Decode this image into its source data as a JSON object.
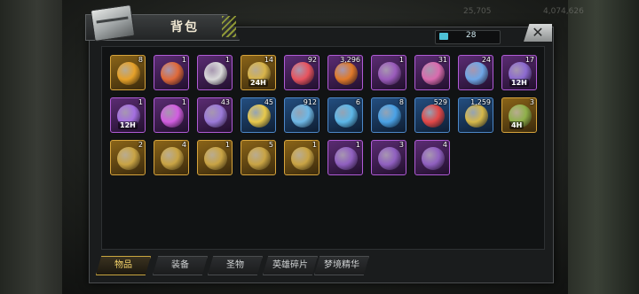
{
  "window": {
    "title": "背包"
  },
  "background": {
    "res_1": "25,705",
    "res_2": "4,074,626"
  },
  "capacity": {
    "value": "28"
  },
  "close_label": "✕",
  "items": [
    {
      "count": "8",
      "rarity": "gold",
      "glyph": "pumpkin-icon",
      "color": "#e6a12a",
      "badge": ""
    },
    {
      "count": "1",
      "rarity": "purple",
      "glyph": "orb-icon",
      "color": "#e06a3a",
      "badge": ""
    },
    {
      "count": "1",
      "rarity": "purple",
      "glyph": "medal-icon",
      "color": "#d9d9d9",
      "badge": ""
    },
    {
      "count": "14",
      "rarity": "gold",
      "glyph": "card-icon",
      "color": "#d8b44a",
      "badge": "24H"
    },
    {
      "count": "92",
      "rarity": "purple",
      "glyph": "bottlecap-icon",
      "color": "#e8545f",
      "badge": ""
    },
    {
      "count": "3,296",
      "rarity": "purple",
      "glyph": "pumpkin-icon",
      "color": "#e07a2a",
      "badge": ""
    },
    {
      "count": "1",
      "rarity": "purple",
      "glyph": "box-icon",
      "color": "#9a5bbb",
      "badge": ""
    },
    {
      "count": "31",
      "rarity": "purple",
      "glyph": "film-icon",
      "color": "#d96cae",
      "badge": ""
    },
    {
      "count": "24",
      "rarity": "purple",
      "glyph": "disc-icon",
      "color": "#6fa6e6",
      "badge": ""
    },
    {
      "count": "17",
      "rarity": "purple",
      "glyph": "card-icon",
      "color": "#8c6ad0",
      "badge": "12H"
    },
    {
      "count": "1",
      "rarity": "purple",
      "glyph": "card-icon",
      "color": "#a46fe0",
      "badge": "12H"
    },
    {
      "count": "1",
      "rarity": "purple",
      "glyph": "gem-icon",
      "color": "#d25ee0",
      "badge": ""
    },
    {
      "count": "43",
      "rarity": "purple",
      "glyph": "badge-icon",
      "color": "#9b7ad9",
      "badge": ""
    },
    {
      "count": "45",
      "rarity": "blue",
      "glyph": "star-icon",
      "color": "#e8c94c",
      "badge": ""
    },
    {
      "count": "912",
      "rarity": "blue",
      "glyph": "ticket-icon",
      "color": "#6fb8e6",
      "badge": ""
    },
    {
      "count": "6",
      "rarity": "blue",
      "glyph": "coin-icon",
      "color": "#5db7e8",
      "badge": ""
    },
    {
      "count": "8",
      "rarity": "blue",
      "glyph": "coin-icon",
      "color": "#4aa2e6",
      "badge": ""
    },
    {
      "count": "529",
      "rarity": "blue",
      "glyph": "chip-icon",
      "color": "#e24848",
      "badge": ""
    },
    {
      "count": "1,259",
      "rarity": "blue",
      "glyph": "bullet-icon",
      "color": "#d6b84a",
      "badge": ""
    },
    {
      "count": "3",
      "rarity": "gold",
      "glyph": "card-icon",
      "color": "#8fb04a",
      "badge": "4H"
    },
    {
      "count": "2",
      "rarity": "gold",
      "glyph": "weapon-crate-icon",
      "color": "#c9a445",
      "badge": ""
    },
    {
      "count": "4",
      "rarity": "gold",
      "glyph": "weapon-crate-icon",
      "color": "#c9a445",
      "badge": ""
    },
    {
      "count": "1",
      "rarity": "gold",
      "glyph": "weapon-crate-icon",
      "color": "#c9a445",
      "badge": ""
    },
    {
      "count": "5",
      "rarity": "gold",
      "glyph": "weapon-crate-icon",
      "color": "#c9a445",
      "badge": ""
    },
    {
      "count": "1",
      "rarity": "gold",
      "glyph": "weapon-crate-icon",
      "color": "#c9a445",
      "badge": ""
    },
    {
      "count": "1",
      "rarity": "purple",
      "glyph": "weapon-crate-icon",
      "color": "#9060c0",
      "badge": ""
    },
    {
      "count": "3",
      "rarity": "purple",
      "glyph": "weapon-crate-icon",
      "color": "#9060c0",
      "badge": ""
    },
    {
      "count": "4",
      "rarity": "purple",
      "glyph": "weapon-crate-icon",
      "color": "#9060c0",
      "badge": ""
    }
  ],
  "tabs": [
    {
      "label": "物品",
      "active": true
    },
    {
      "label": "装备",
      "active": false
    },
    {
      "label": "圣物",
      "active": false
    },
    {
      "label": "英雄碎片",
      "active": false
    },
    {
      "label": "梦境精华",
      "active": false
    }
  ]
}
